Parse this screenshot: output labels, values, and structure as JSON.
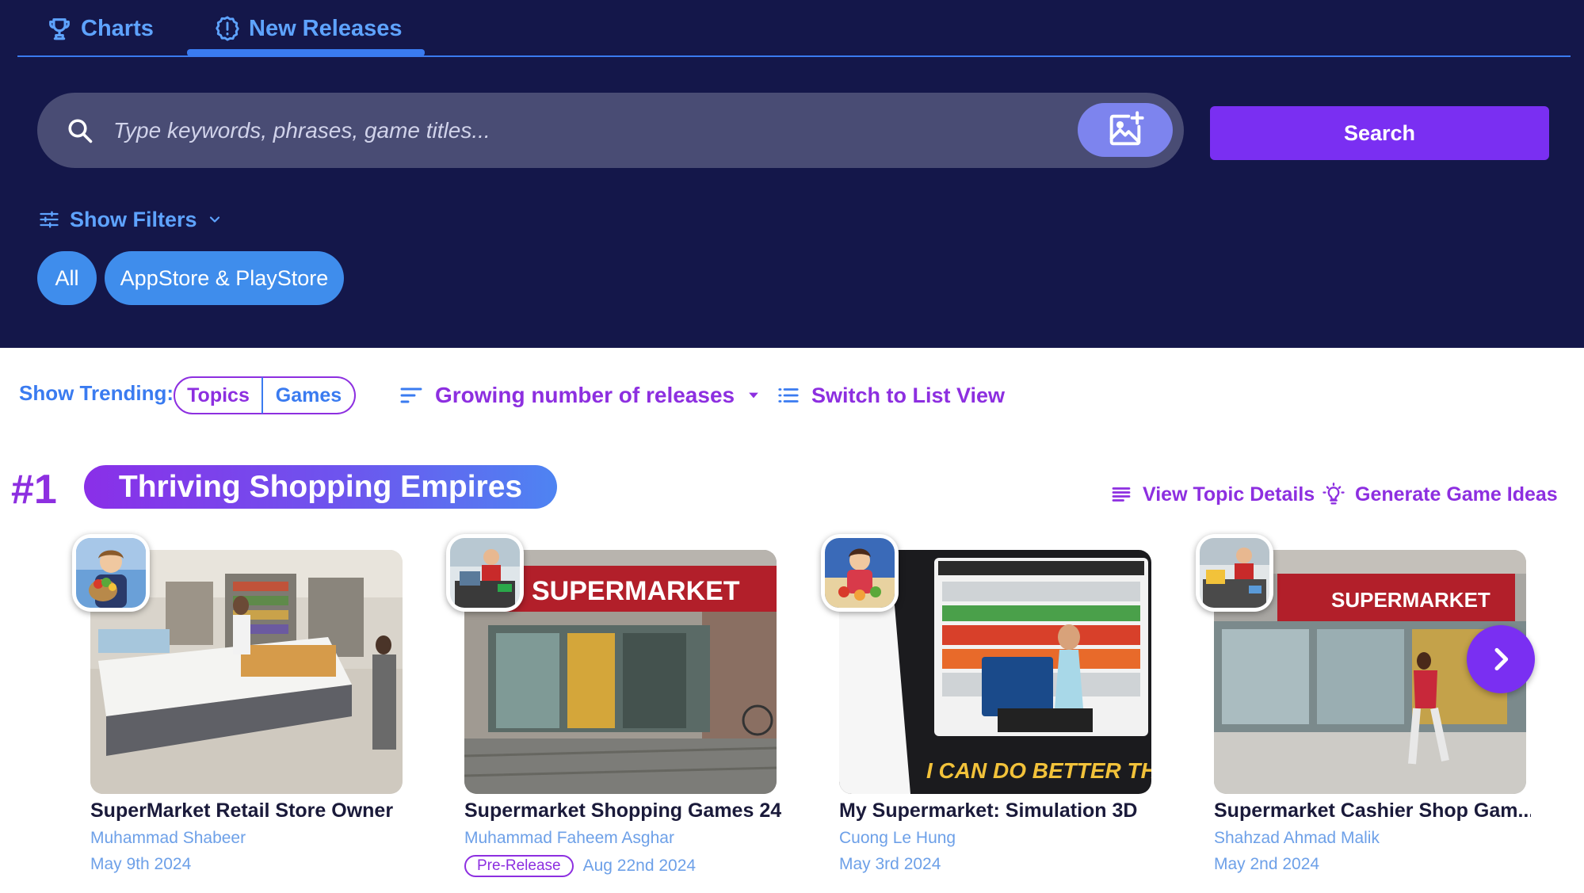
{
  "tabs": [
    {
      "label": "Charts",
      "icon": "trophy-icon"
    },
    {
      "label": "New Releases",
      "icon": "alert-badge-icon",
      "active": true
    }
  ],
  "search": {
    "placeholder": "Type keywords, phrases, game titles...",
    "button_label": "Search",
    "image_search_icon": "image-plus-icon"
  },
  "filters": {
    "toggle_label": "Show Filters",
    "chips": [
      "All",
      "AppStore & PlayStore"
    ]
  },
  "trending": {
    "label": "Show Trending:",
    "options": [
      "Topics",
      "Games"
    ],
    "selected": "Topics",
    "sort_label": "Growing number of releases",
    "view_toggle": "Switch to List View"
  },
  "topic": {
    "rank": "#1",
    "title": "Thriving Shopping Empires",
    "view_details": "View Topic Details",
    "generate_ideas": "Generate Game Ideas"
  },
  "games": [
    {
      "title": "SuperMarket Retail Store Owner",
      "developer": "Muhammad Shabeer",
      "date": "May 9th 2024",
      "badge": ""
    },
    {
      "title": "Supermarket Shopping Games 24",
      "developer": "Muhammad Faheem Asghar",
      "date": "Aug 22nd 2024",
      "badge": "Pre-Release",
      "sign": "SUPERMARKET"
    },
    {
      "title": "My Supermarket: Simulation 3D",
      "developer": "Cuong Le Hung",
      "date": "May 3rd 2024",
      "badge": "",
      "banner": "I CAN DO BETTER THAN T"
    },
    {
      "title": "Supermarket Cashier Shop Gam...",
      "developer": "Shahzad Ahmad Malik",
      "date": "May 2nd 2024",
      "badge": "",
      "sign": "SUPERMARKET"
    }
  ],
  "colors": {
    "header_bg": "#14174a",
    "accent_blue": "#3a7bf0",
    "accent_purple": "#8d2fe0",
    "button_purple": "#7a2ff2"
  }
}
